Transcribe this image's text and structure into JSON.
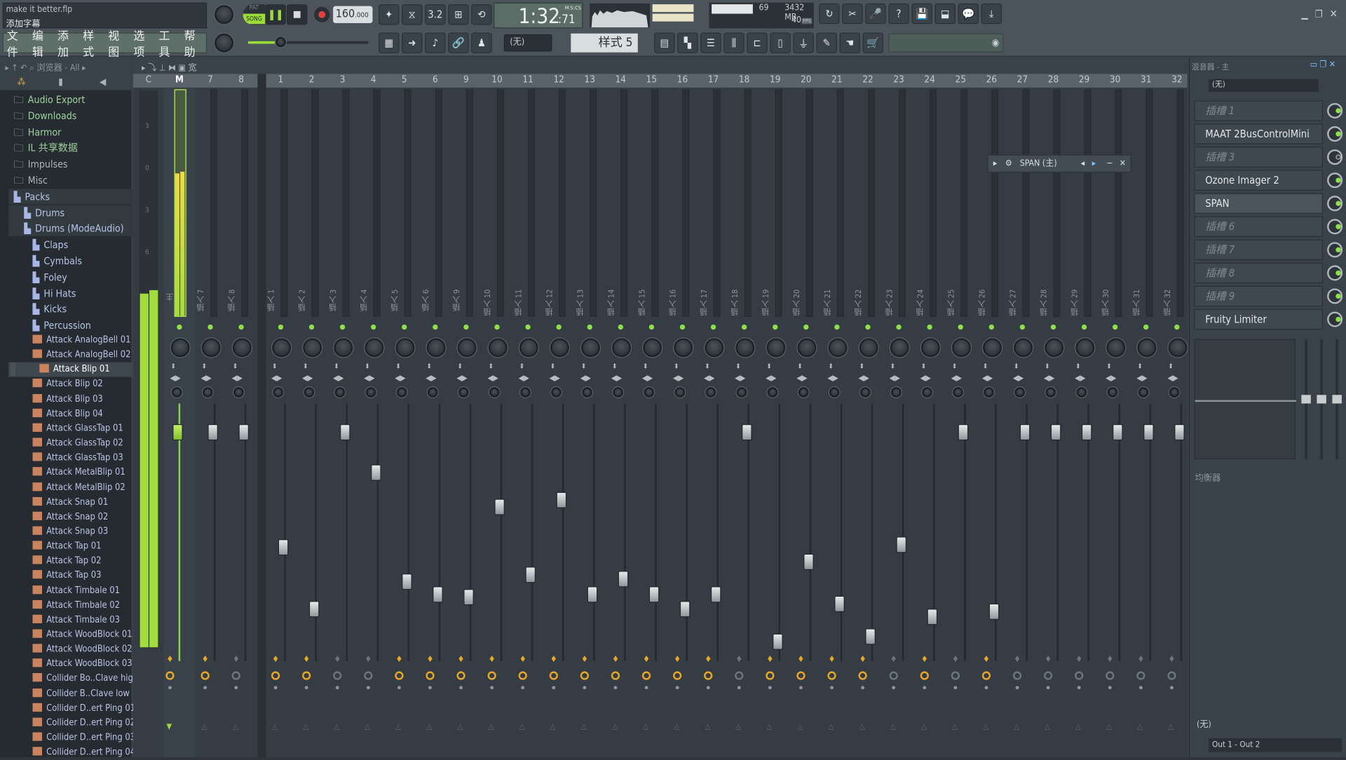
{
  "window": {
    "file_name": "make it better.flp",
    "hint": "添加字幕"
  },
  "menu": [
    "文件",
    "编辑",
    "添加",
    "样式",
    "视图",
    "选项",
    "工具",
    "帮助"
  ],
  "transport": {
    "pat_label": "PAT",
    "song_label": "SONG",
    "mode": "SONG",
    "tempo": "160",
    "tempo_frac": ".000",
    "time": "1:32",
    "time_cs": ":71",
    "time_unit": "M:S:CS",
    "pattern": "样式 5",
    "snap": "(无)"
  },
  "perf": {
    "cpu": "69",
    "ram": "3432 MB",
    "fps": "40",
    "fps_label": "FPS"
  },
  "browser": {
    "title": "浏览器 - All",
    "items": [
      {
        "label": "Audio Export",
        "type": "folder-link",
        "depth": 0
      },
      {
        "label": "Downloads",
        "type": "folder-link",
        "depth": 0
      },
      {
        "label": "Harmor",
        "type": "folder-link",
        "depth": 0
      },
      {
        "label": "IL 共享数据",
        "type": "folder-link",
        "depth": 0
      },
      {
        "label": "Impulses",
        "type": "folder",
        "depth": 0
      },
      {
        "label": "Misc",
        "type": "folder",
        "depth": 0
      },
      {
        "label": "Packs",
        "type": "pack",
        "depth": 0
      },
      {
        "label": "Drums",
        "type": "pack",
        "depth": 1
      },
      {
        "label": "Drums (ModeAudio)",
        "type": "pack",
        "depth": 1
      },
      {
        "label": "Claps",
        "type": "pack",
        "depth": 2
      },
      {
        "label": "Cymbals",
        "type": "pack",
        "depth": 2
      },
      {
        "label": "Foley",
        "type": "pack",
        "depth": 2
      },
      {
        "label": "Hi Hats",
        "type": "pack",
        "depth": 2
      },
      {
        "label": "Kicks",
        "type": "pack",
        "depth": 2
      },
      {
        "label": "Percussion",
        "type": "pack",
        "depth": 2
      }
    ],
    "files": [
      "Attack AnalogBell 01",
      "Attack AnalogBell 02",
      "Attack Blip 01",
      "Attack Blip 02",
      "Attack Blip 03",
      "Attack Blip 04",
      "Attack GlassTap 01",
      "Attack GlassTap 02",
      "Attack GlassTap 03",
      "Attack MetalBlip 01",
      "Attack MetalBlip 02",
      "Attack Snap 01",
      "Attack Snap 02",
      "Attack Snap 03",
      "Attack Tap 01",
      "Attack Tap 02",
      "Attack Tap 03",
      "Attack Timbale 01",
      "Attack Timbale 02",
      "Attack Timbale 03",
      "Attack WoodBlock 01",
      "Attack WoodBlock 02",
      "Attack WoodBlock 03",
      "Collider Bo..Clave high",
      "Collider B..Clave low",
      "Collider D..ert Ping 01",
      "Collider D..ert Ping 02",
      "Collider D..ert Ping 03",
      "Collider D..ert Ping 04"
    ],
    "selected_file": "Attack Blip 01"
  },
  "mixer": {
    "toolbar_label": "宽",
    "master_meter_scale": [
      "3",
      "0",
      "3",
      "6"
    ],
    "master": {
      "num": "M",
      "label": "主",
      "volume_pct": 92,
      "send": true
    },
    "current_num": "C",
    "channels": [
      {
        "num": "7",
        "label": "插入 7",
        "volume_pct": 92,
        "send": true
      },
      {
        "num": "8",
        "label": "插入 8",
        "volume_pct": 92,
        "send": false
      },
      {
        "num": "1",
        "label": "插入 1",
        "volume_pct": 46,
        "send": true
      },
      {
        "num": "2",
        "label": "插入 2",
        "volume_pct": 21,
        "send": true
      },
      {
        "num": "3",
        "label": "插入 3",
        "volume_pct": 92,
        "send": false
      },
      {
        "num": "4",
        "label": "插入 4",
        "volume_pct": 76,
        "send": false
      },
      {
        "num": "5",
        "label": "插入 5",
        "volume_pct": 32,
        "send": true
      },
      {
        "num": "6",
        "label": "插入 6",
        "volume_pct": 27,
        "send": true
      },
      {
        "num": "9",
        "label": "插入 9",
        "volume_pct": 26,
        "send": true
      },
      {
        "num": "10",
        "label": "插入 10",
        "volume_pct": 62,
        "send": true
      },
      {
        "num": "11",
        "label": "插入 11",
        "volume_pct": 35,
        "send": true
      },
      {
        "num": "12",
        "label": "插入 12",
        "volume_pct": 65,
        "send": true
      },
      {
        "num": "13",
        "label": "插入 13",
        "volume_pct": 27,
        "send": true
      },
      {
        "num": "14",
        "label": "插入 14",
        "volume_pct": 33,
        "send": true
      },
      {
        "num": "15",
        "label": "插入 15",
        "volume_pct": 27,
        "send": true
      },
      {
        "num": "16",
        "label": "插入 16",
        "volume_pct": 21,
        "send": true
      },
      {
        "num": "17",
        "label": "插入 17",
        "volume_pct": 27,
        "send": true
      },
      {
        "num": "18",
        "label": "插入 18",
        "volume_pct": 92,
        "send": false
      },
      {
        "num": "19",
        "label": "插入 19",
        "volume_pct": 8,
        "send": true
      },
      {
        "num": "20",
        "label": "插入 20",
        "volume_pct": 40,
        "send": true
      },
      {
        "num": "21",
        "label": "插入 21",
        "volume_pct": 23,
        "send": true
      },
      {
        "num": "22",
        "label": "插入 22",
        "volume_pct": 10,
        "send": true
      },
      {
        "num": "23",
        "label": "插入 23",
        "volume_pct": 47,
        "send": false
      },
      {
        "num": "24",
        "label": "插入 24",
        "volume_pct": 18,
        "send": true
      },
      {
        "num": "25",
        "label": "插入 25",
        "volume_pct": 92,
        "send": false
      },
      {
        "num": "26",
        "label": "插入 26",
        "volume_pct": 20,
        "send": true
      },
      {
        "num": "27",
        "label": "插入 27",
        "volume_pct": 92,
        "send": false
      },
      {
        "num": "28",
        "label": "插入 28",
        "volume_pct": 92,
        "send": false
      },
      {
        "num": "29",
        "label": "插入 29",
        "volume_pct": 92,
        "send": false
      },
      {
        "num": "30",
        "label": "插入 30",
        "volume_pct": 92,
        "send": false
      },
      {
        "num": "31",
        "label": "插入 31",
        "volume_pct": 92,
        "send": false
      },
      {
        "num": "32",
        "label": "插入 32",
        "volume_pct": 92,
        "send": false
      }
    ]
  },
  "plugin_window": {
    "title": "SPAN (主)"
  },
  "insert_panel": {
    "title": "混音器 - 主",
    "input": "(无)",
    "slots": [
      {
        "label": "插槽 1",
        "empty": true
      },
      {
        "label": "MAAT 2BusControlMini",
        "empty": false
      },
      {
        "label": "插槽 3",
        "empty": true
      },
      {
        "label": "Ozone Imager 2",
        "empty": false
      },
      {
        "label": "SPAN",
        "empty": false
      },
      {
        "label": "插槽 6",
        "empty": true
      },
      {
        "label": "插槽 7",
        "empty": true
      },
      {
        "label": "插槽 8",
        "empty": true
      },
      {
        "label": "插槽 9",
        "empty": true
      },
      {
        "label": "Fruity Limiter",
        "empty": false
      }
    ],
    "eq_label": "均衡器",
    "output_none": "(无)",
    "output": "Out 1 - Out 2"
  },
  "colors": {
    "accent_green": "#9bdc3c",
    "send_orange": "#e8a82a",
    "led_green": "#8ee04a"
  }
}
